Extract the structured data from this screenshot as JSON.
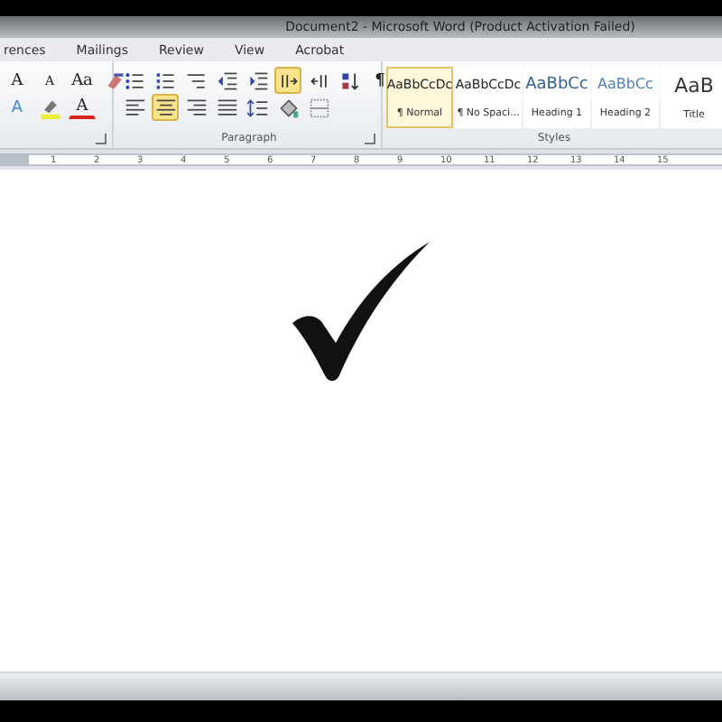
{
  "window": {
    "title": "Document2 - Microsoft Word (Product Activation Failed)"
  },
  "tabs": [
    {
      "label": "rences",
      "selected": false
    },
    {
      "label": "Mailings",
      "selected": false
    },
    {
      "label": "Review",
      "selected": false
    },
    {
      "label": "View",
      "selected": false
    },
    {
      "label": "Acrobat",
      "selected": false
    }
  ],
  "font_group": {
    "row_1": [
      {
        "kind": "grow-font",
        "text": "A"
      },
      {
        "kind": "shrink-font",
        "text": "A"
      },
      {
        "kind": "change-case",
        "text": "Aa"
      },
      {
        "kind": "clear-format"
      }
    ],
    "row_2": [
      {
        "kind": "text-effects",
        "text": "A"
      },
      {
        "kind": "highlight"
      },
      {
        "kind": "font-color",
        "text": "A"
      }
    ]
  },
  "paragraph_group": {
    "label": "Paragraph",
    "row_1": [
      {
        "kind": "bullets",
        "selected": false
      },
      {
        "kind": "numbering",
        "selected": false
      },
      {
        "kind": "multilevel",
        "selected": false
      },
      {
        "kind": "outdent",
        "selected": false
      },
      {
        "kind": "indent",
        "selected": false
      },
      {
        "kind": "ltr",
        "selected": true
      },
      {
        "kind": "rtl",
        "selected": false
      },
      {
        "kind": "sort",
        "selected": false
      },
      {
        "kind": "pilcrow",
        "text": "¶",
        "selected": false
      }
    ],
    "row_2": [
      {
        "kind": "align-left",
        "selected": false
      },
      {
        "kind": "align-center",
        "selected": true
      },
      {
        "kind": "align-right",
        "selected": false
      },
      {
        "kind": "justify",
        "selected": false
      },
      {
        "kind": "line-spacing",
        "selected": false
      },
      {
        "kind": "shading",
        "selected": false
      },
      {
        "kind": "borders",
        "selected": false
      }
    ]
  },
  "styles_group": {
    "label": "Styles",
    "items": [
      {
        "kind": "normal",
        "preview": "AaBbCcDc",
        "label": "¶ Normal",
        "selected": true
      },
      {
        "kind": "normal",
        "preview": "AaBbCcDc",
        "label": "¶ No Spaci...",
        "selected": false
      },
      {
        "kind": "heading1",
        "preview": "AaBbCc",
        "label": "Heading 1",
        "selected": false
      },
      {
        "kind": "heading2",
        "preview": "AaBbCc",
        "label": "Heading 2",
        "selected": false
      },
      {
        "kind": "title",
        "preview": "AaB",
        "label": "Title",
        "selected": false
      }
    ]
  },
  "ruler": [
    "1",
    "2",
    "3",
    "4",
    "5",
    "6",
    "7",
    "8",
    "9",
    "10",
    "11",
    "12",
    "13",
    "14",
    "15"
  ]
}
